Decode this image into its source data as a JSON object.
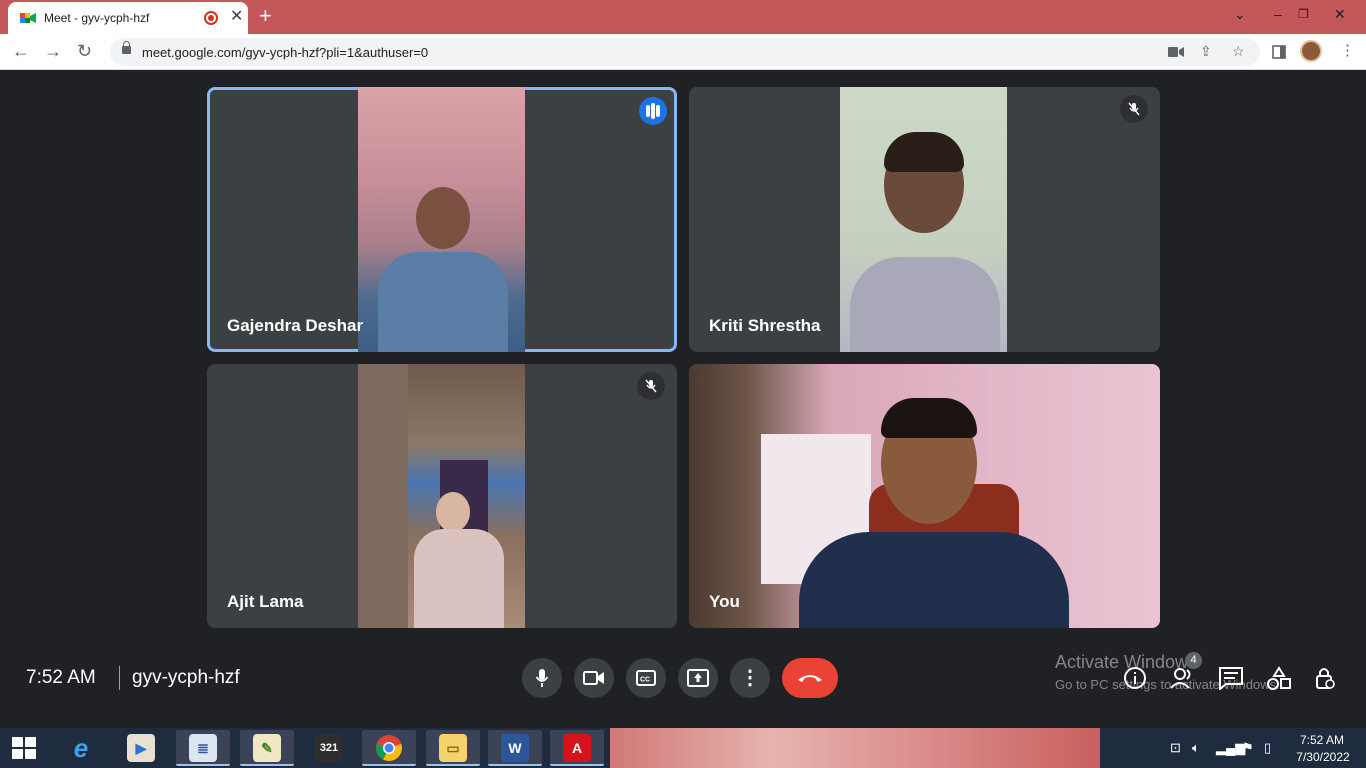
{
  "browser": {
    "tab_title": "Meet - gyv-ycph-hzf",
    "url": "meet.google.com/gyv-ycph-hzf?pli=1&authuser=0"
  },
  "participants": [
    {
      "name": "Gajendra Deshar",
      "state": "speaking"
    },
    {
      "name": "Kriti Shrestha",
      "state": "muted"
    },
    {
      "name": "Ajit Lama",
      "state": "muted"
    },
    {
      "name": "You",
      "state": "self"
    }
  ],
  "meeting": {
    "time": "7:52 AM",
    "code": "gyv-ycph-hzf",
    "participant_count": "4"
  },
  "controls": {
    "icons": [
      "microphone-icon",
      "camera-icon",
      "captions-icon",
      "present-icon",
      "more-options-icon",
      "end-call-icon"
    ]
  },
  "watermark": {
    "line1": "Activate Windows",
    "line2": "Go to PC settings to activate Windows."
  },
  "taskbar": {
    "time": "7:52 AM",
    "date": "7/30/2022"
  },
  "colors": {
    "titlebar": "#c3575a",
    "meet_bg": "#202124",
    "tile_bg": "#3c4043",
    "active_outline": "#8ab4f8",
    "speaking_blue": "#1a73e8",
    "end_call_red": "#ea4335"
  }
}
